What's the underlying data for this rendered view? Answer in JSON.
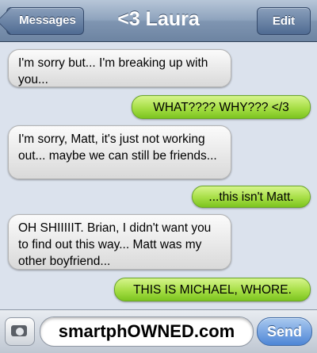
{
  "navbar": {
    "title": "<3 Laura",
    "back_label": "Messages",
    "edit_label": "Edit"
  },
  "messages": [
    {
      "side": "in",
      "text": "I'm sorry but... I'm breaking up with you..."
    },
    {
      "side": "out",
      "text": "WHAT???? WHY??? </3"
    },
    {
      "side": "in",
      "text": "I'm sorry, Matt, it's just not working out... maybe we can still be friends..."
    },
    {
      "side": "out",
      "text": "...this isn't Matt."
    },
    {
      "side": "in",
      "text": "OH SHIIIIIT.  Brian, I didn't want you to find out this way... Matt was my other boyfriend..."
    },
    {
      "side": "out",
      "text": "THIS IS MICHAEL, WHORE."
    }
  ],
  "composer": {
    "input_value": "smartphOWNED.com",
    "send_label": "Send",
    "camera_icon": "camera-icon"
  },
  "colors": {
    "nav_bar": "#8ea3bd",
    "outgoing_bubble": "#a6de45",
    "incoming_bubble": "#e6e6e6",
    "background": "#dbe2ed",
    "send_button": "#4e86d6"
  }
}
